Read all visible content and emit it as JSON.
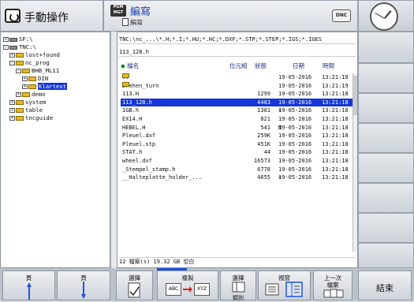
{
  "header": {
    "mode_title": "手動操作",
    "pgm_badge": "PGM MGT",
    "prog_title": "編寫",
    "prog_subtitle": "編寫",
    "dnc_label": "DNC"
  },
  "tree": {
    "items": [
      {
        "prefix": "⊞",
        "icon": "drive",
        "label": "SF:\\",
        "indent": 0
      },
      {
        "prefix": "⊟",
        "icon": "drive",
        "label": "TNC:\\",
        "indent": 0
      },
      {
        "prefix": "⊞",
        "icon": "folder",
        "label": "lost+found",
        "indent": 1
      },
      {
        "prefix": "⊟",
        "icon": "folder",
        "label": "nc_prog",
        "indent": 1
      },
      {
        "prefix": "⊟",
        "icon": "folder",
        "label": "BHB_ML11",
        "indent": 2
      },
      {
        "prefix": "⊞",
        "icon": "folder",
        "label": "DIN",
        "indent": 3
      },
      {
        "prefix": "⊞",
        "icon": "folder",
        "label": "Klartext",
        "indent": 3,
        "selected": true
      },
      {
        "prefix": "⊞",
        "icon": "folder",
        "label": "demo",
        "indent": 2
      },
      {
        "prefix": "⊞",
        "icon": "folder",
        "label": "system",
        "indent": 1
      },
      {
        "prefix": "⊞",
        "icon": "folder",
        "label": "table",
        "indent": 1
      },
      {
        "prefix": "⊞",
        "icon": "folder",
        "label": "tncguide",
        "indent": 1
      }
    ]
  },
  "files": {
    "path": "TNC:\\nc_...\\*.H;*.I;*.HU;*.HC;*.DXF;*.STP;*.STEP;*.IGS;*.IGES",
    "filename": "113_128.h",
    "columns": {
      "name": "檔名",
      "size": "位元組",
      "status": "狀態",
      "date": "日期",
      "time": "時間"
    },
    "rows": [
      {
        "name": "..",
        "folder": true,
        "size": "",
        "status": "",
        "date": "19-05-2016",
        "time": "13:21:18"
      },
      {
        "name": "Drehen_turn",
        "folder": true,
        "size": "",
        "status": "",
        "date": "19-05-2016",
        "time": "13:21:19"
      },
      {
        "name": "113.H",
        "size": "1299",
        "status": "",
        "date": "19-05-2016",
        "time": "13:21:18"
      },
      {
        "name": "113_128.h",
        "size": "4483",
        "status": "",
        "date": "19-05-2016",
        "time": "13:21:18",
        "selected": true
      },
      {
        "name": "1GB.h",
        "size": "1381",
        "status": "+",
        "date": "19-05-2016",
        "time": "13:21:18"
      },
      {
        "name": "EX14.H",
        "size": "821",
        "status": "",
        "date": "19-05-2016",
        "time": "13:21:18"
      },
      {
        "name": "HEBEL.H",
        "size": "541",
        "status": "M",
        "date": "19-05-2016",
        "time": "13:21:18"
      },
      {
        "name": "Pleuel.dxf",
        "size": "259K",
        "status": "",
        "date": "19-05-2016",
        "time": "13:21:18"
      },
      {
        "name": "Pleuel.stp",
        "size": "451K",
        "status": "",
        "date": "19-05-2016",
        "time": "13:21:18"
      },
      {
        "name": "STAT.h",
        "size": "44",
        "status": "",
        "date": "19-05-2016",
        "time": "13:21:18"
      },
      {
        "name": "wheel.dxf",
        "size": "16573",
        "status": "",
        "date": "19-05-2016",
        "time": "13:21:18"
      },
      {
        "name": "_Stempel_stamp.h",
        "size": "6778",
        "status": "",
        "date": "19-05-2016",
        "time": "13:21:18"
      },
      {
        "name": "__Halteplatte_holder_...",
        "size": "4655",
        "status": "+",
        "date": "19-05-2016",
        "time": "13:21:18"
      }
    ],
    "status_text": "12  檔案(s)  19.32 GB 空白"
  },
  "softkeys": {
    "page_up": "頁",
    "page_down": "頁",
    "select": "選擇",
    "copy": "複製",
    "copy_from": "ABC",
    "copy_to": "XYZ",
    "choose_type": "選擇",
    "type_label": "類別",
    "window": "視窗",
    "last_file_1": "上一次",
    "last_file_2": "檔案",
    "end": "結束"
  },
  "colors": {
    "selection": "#1536d8",
    "folder": "#e2b82a",
    "accent": "#2253d8"
  }
}
